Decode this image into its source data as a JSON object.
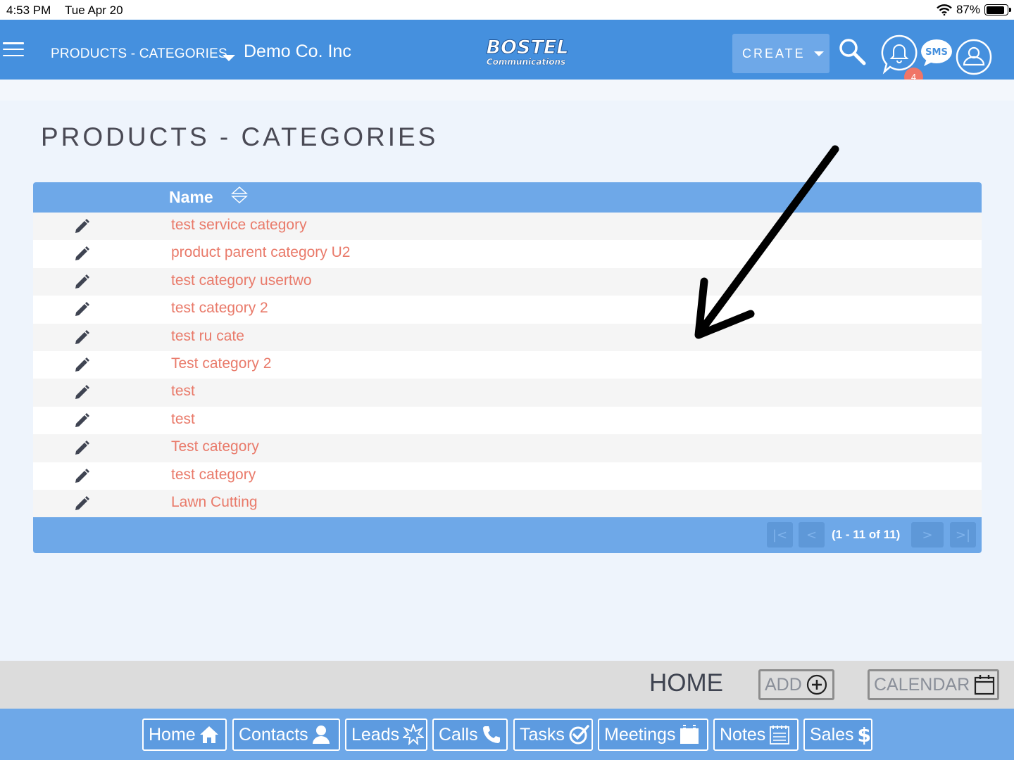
{
  "status_bar": {
    "time": "4:53 PM",
    "date": "Tue Apr 20",
    "battery": "87%",
    "battery_level": 0.87
  },
  "header": {
    "breadcrumb": "PRODUCTS - CATEGORIES",
    "company": "Demo Co. Inc",
    "logo_text": "BOSTEL",
    "logo_subtext": "Communications",
    "create_label": "CREATE",
    "notification_count": "4",
    "sms_label": "SMS"
  },
  "page": {
    "title": "PRODUCTS - CATEGORIES"
  },
  "table": {
    "column_name": "Name",
    "rows": [
      "test service category",
      "product parent category U2",
      "test category usertwo",
      "test category 2",
      "test ru cate",
      "Test category 2",
      "test",
      "test",
      "Test category",
      "test category",
      "Lawn Cutting"
    ],
    "pagination_text": "(1 - 11 of 11)"
  },
  "home_bar": {
    "home_label": "HOME",
    "add_label": "ADD",
    "calendar_label": "CALENDAR"
  },
  "nav": {
    "home": "Home",
    "contacts": "Contacts",
    "leads": "Leads",
    "calls": "Calls",
    "tasks": "Tasks",
    "meetings": "Meetings",
    "notes": "Notes",
    "sales": "Sales"
  },
  "colors": {
    "header_blue": "#4590de",
    "table_blue": "#6ea8e8",
    "link_coral": "#e97a6a",
    "badge_red": "#f07567"
  }
}
